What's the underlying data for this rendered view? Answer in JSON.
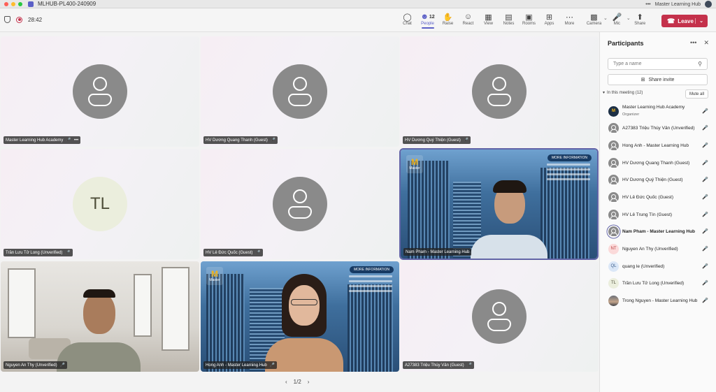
{
  "window": {
    "title": "MLHUB-PL400-240909",
    "org_name": "Master Learning Hub"
  },
  "toolbar": {
    "timer": "28:42",
    "buttons": [
      {
        "label": "Chat",
        "icon": "chat-icon"
      },
      {
        "label": "People",
        "icon": "people-icon",
        "count": "12"
      },
      {
        "label": "Raise",
        "icon": "raise-hand-icon"
      },
      {
        "label": "React",
        "icon": "react-icon"
      },
      {
        "label": "View",
        "icon": "view-icon"
      },
      {
        "label": "Notes",
        "icon": "notes-icon"
      },
      {
        "label": "Rooms",
        "icon": "rooms-icon"
      },
      {
        "label": "Apps",
        "icon": "apps-icon"
      },
      {
        "label": "More",
        "icon": "more-icon"
      }
    ],
    "camera_label": "Camera",
    "mic_label": "Mic",
    "share_label": "Share",
    "leave_label": "Leave"
  },
  "tiles": [
    {
      "name": "Master Learning Hub Academy",
      "type": "avatar"
    },
    {
      "name": "HV Dương Quang Thanh (Guest)",
      "type": "avatar"
    },
    {
      "name": "HV Dương Quý Thiện (Guest)",
      "type": "avatar"
    },
    {
      "name": "Trần Lưu Tử Long (Unverified)",
      "type": "initials",
      "initials": "TL"
    },
    {
      "name": "HV Lê Đức Quốc (Guest)",
      "type": "avatar"
    },
    {
      "name": "Nam Pham - Master Learning Hub",
      "type": "video"
    },
    {
      "name": "Nguyen An Thy (Unverified)",
      "type": "video"
    },
    {
      "name": "Hong Anh - Master Learning Hub",
      "type": "video"
    },
    {
      "name": "A27383 Triệu Thúy Vân (Guest)",
      "type": "avatar"
    }
  ],
  "video_overlay": {
    "brand_letter": "M",
    "brand_text": "Master",
    "more_info": "MORE INFORMATION"
  },
  "pager": {
    "text": "1/2"
  },
  "panel": {
    "title": "Participants",
    "search_placeholder": "Type a name",
    "share_invite": "Share invite",
    "section": "In this meeting (12)",
    "mute_all": "Mute all",
    "participants": [
      {
        "name": "Master Learning Hub Academy",
        "role": "Organizer",
        "avatar": "org",
        "initials": "M"
      },
      {
        "name": "A27383 Triệu Thúy Vân (Unverified)",
        "avatar": "generic"
      },
      {
        "name": "Hong Anh - Master Learning Hub",
        "avatar": "generic"
      },
      {
        "name": "HV Dương Quang Thanh (Guest)",
        "avatar": "generic"
      },
      {
        "name": "HV Dương Quý Thiện (Guest)",
        "avatar": "generic"
      },
      {
        "name": "HV Lê Đức Quốc (Guest)",
        "avatar": "generic"
      },
      {
        "name": "HV Lê Trung Tín (Guest)",
        "avatar": "generic"
      },
      {
        "name": "Nam Pham - Master Learning Hub",
        "avatar": "generic",
        "bold": true,
        "mic_on": true
      },
      {
        "name": "Nguyen An Thy (Unverified)",
        "avatar": "nt",
        "initials": "NT"
      },
      {
        "name": "quang le (Unverified)",
        "avatar": "ql",
        "initials": "QL"
      },
      {
        "name": "Trần Lưu Tử Long (Unverified)",
        "avatar": "tl",
        "initials": "TL"
      },
      {
        "name": "Trong Nguyen - Master Learning Hub",
        "avatar": "photo"
      }
    ]
  },
  "colors": {
    "accent": "#5b5fc7",
    "leave": "#c4314b"
  }
}
